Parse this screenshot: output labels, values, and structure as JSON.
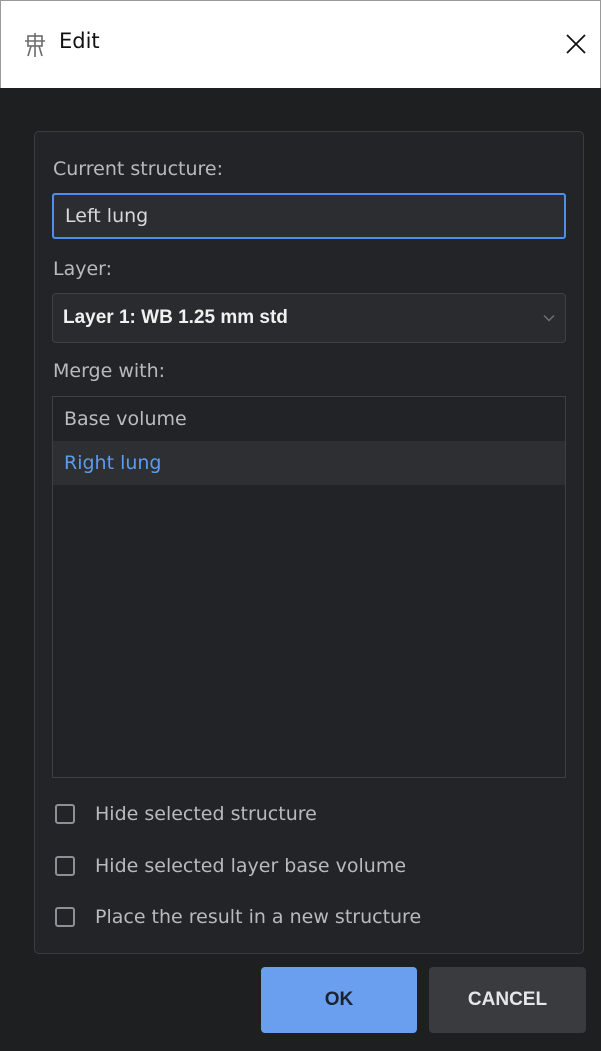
{
  "window": {
    "title": "Edit",
    "icons": {
      "app": "app-logo-icon",
      "close": "close-icon"
    }
  },
  "form": {
    "current_structure_label": "Current structure:",
    "current_structure_value": "Left lung",
    "layer_label": "Layer:",
    "layer_selected": "Layer 1: WB 1.25 mm std",
    "merge_with_label": "Merge with:",
    "merge_options": [
      {
        "label": "Base volume",
        "highlighted": false
      },
      {
        "label": "Right lung",
        "highlighted": true
      }
    ],
    "checkboxes": [
      {
        "label": "Hide selected structure",
        "checked": false
      },
      {
        "label": "Hide selected layer base volume",
        "checked": false
      },
      {
        "label": "Place the result in a new structure",
        "checked": false
      }
    ]
  },
  "buttons": {
    "ok": "OK",
    "cancel": "CANCEL"
  },
  "colors": {
    "background": "#1e1f21",
    "accent": "#4a8ff0",
    "highlight_text": "#5b9cf0",
    "ok_button": "#6a9ff0",
    "cancel_button": "#3a3b3f"
  }
}
